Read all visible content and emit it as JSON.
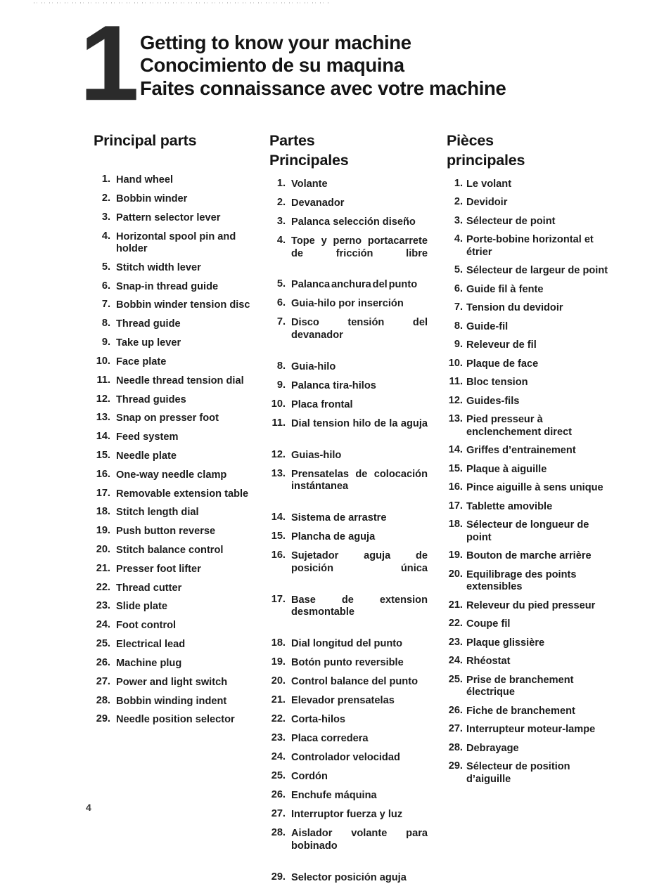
{
  "document": {
    "chapter_number": "1",
    "page_number": "4",
    "titles": [
      "Getting to know your machine",
      "Conocimiento de su maquina",
      "Faites connaissance avec votre machine"
    ]
  },
  "columns": {
    "english": {
      "heading": "Principal parts",
      "items": [
        {
          "num": "1.",
          "label": "Hand wheel"
        },
        {
          "num": "2.",
          "label": "Bobbin winder"
        },
        {
          "num": "3.",
          "label": "Pattern selector lever"
        },
        {
          "num": "4.",
          "label": "Horizontal spool pin and holder"
        },
        {
          "num": "5.",
          "label": "Stitch width lever"
        },
        {
          "num": "6.",
          "label": "Snap-in thread guide"
        },
        {
          "num": "7.",
          "label": "Bobbin winder tension disc"
        },
        {
          "num": "8.",
          "label": "Thread guide"
        },
        {
          "num": "9.",
          "label": "Take up lever"
        },
        {
          "num": "10.",
          "label": "Face plate"
        },
        {
          "num": "11.",
          "label": "Needle thread tension dial"
        },
        {
          "num": "12.",
          "label": "Thread guides"
        },
        {
          "num": "13.",
          "label": "Snap on presser foot"
        },
        {
          "num": "14.",
          "label": "Feed system"
        },
        {
          "num": "15.",
          "label": "Needle plate"
        },
        {
          "num": "16.",
          "label": "One-way needle clamp"
        },
        {
          "num": "17.",
          "label": "Removable extension table"
        },
        {
          "num": "18.",
          "label": "Stitch length dial"
        },
        {
          "num": "19.",
          "label": "Push button reverse"
        },
        {
          "num": "20.",
          "label": "Stitch balance control"
        },
        {
          "num": "21.",
          "label": "Presser foot lifter"
        },
        {
          "num": "22.",
          "label": "Thread cutter"
        },
        {
          "num": "23.",
          "label": "Slide plate"
        },
        {
          "num": "24.",
          "label": "Foot control"
        },
        {
          "num": "25.",
          "label": "Electrical lead"
        },
        {
          "num": "26.",
          "label": "Machine plug"
        },
        {
          "num": "27.",
          "label": "Power and light switch"
        },
        {
          "num": "28.",
          "label": "Bobbin winding indent"
        },
        {
          "num": "29.",
          "label": "Needle position selector"
        }
      ]
    },
    "spanish": {
      "heading": "Partes Principales",
      "heading_line1": "Partes",
      "heading_line2": "Principales",
      "items": [
        {
          "num": "1.",
          "label": "Volante"
        },
        {
          "num": "2.",
          "label": "Devanador"
        },
        {
          "num": "3.",
          "label": "Palanca selección diseño"
        },
        {
          "num": "4.",
          "label": "Tope y perno portacarrete de fricción libre"
        },
        {
          "num": "5.",
          "label": "Palanca anchura del punto"
        },
        {
          "num": "6.",
          "label": "Guia-hilo por inserción"
        },
        {
          "num": "7.",
          "label": "Disco tensión del devanador"
        },
        {
          "num": "8.",
          "label": "Guia-hilo"
        },
        {
          "num": "9.",
          "label": "Palanca tira-hilos"
        },
        {
          "num": "10.",
          "label": "Placa frontal"
        },
        {
          "num": "11.",
          "label": "Dial tension hilo de la aguja"
        },
        {
          "num": "12.",
          "label": "Guias-hilo"
        },
        {
          "num": "13.",
          "label": "Prensatelas de colocación instántanea"
        },
        {
          "num": "14.",
          "label": "Sistema de arrastre"
        },
        {
          "num": "15.",
          "label": "Plancha de aguja"
        },
        {
          "num": "16.",
          "label": "Sujetador aguja de posición única"
        },
        {
          "num": "17.",
          "label": "Base de extension desmontable"
        },
        {
          "num": "18.",
          "label": "Dial longitud del punto"
        },
        {
          "num": "19.",
          "label": "Botón punto reversible"
        },
        {
          "num": "20.",
          "label": "Control balance del punto"
        },
        {
          "num": "21.",
          "label": "Elevador prensatelas"
        },
        {
          "num": "22.",
          "label": "Corta-hilos"
        },
        {
          "num": "23.",
          "label": "Placa corredera"
        },
        {
          "num": "24.",
          "label": "Controlador velocidad"
        },
        {
          "num": "25.",
          "label": "Cordón"
        },
        {
          "num": "26.",
          "label": "Enchufe máquina"
        },
        {
          "num": "27.",
          "label": "Interruptor fuerza y luz"
        },
        {
          "num": "28.",
          "label": "Aislador volante para bobinado"
        },
        {
          "num": "29.",
          "label": "Selector posición aguja"
        }
      ]
    },
    "french": {
      "heading": "Pièces principales",
      "heading_line1": "Pièces",
      "heading_line2": "principales",
      "items": [
        {
          "num": "1.",
          "label": "Le volant"
        },
        {
          "num": "2.",
          "label": "Devidoir"
        },
        {
          "num": "3.",
          "label": "Sélecteur de point"
        },
        {
          "num": "4.",
          "label": "Porte-bobine horizontal et étrier"
        },
        {
          "num": "5.",
          "label": "Sélecteur de largeur de point"
        },
        {
          "num": "6.",
          "label": "Guide fil à fente"
        },
        {
          "num": "7.",
          "label": "Tension du devidoir"
        },
        {
          "num": "8.",
          "label": "Guide-fil"
        },
        {
          "num": "9.",
          "label": "Releveur de fil"
        },
        {
          "num": "10.",
          "label": "Plaque de face"
        },
        {
          "num": "11.",
          "label": "Bloc tension"
        },
        {
          "num": "12.",
          "label": "Guides-fils"
        },
        {
          "num": "13.",
          "label": "Pied presseur à enclenchement direct"
        },
        {
          "num": "14.",
          "label": "Griffes d’entrainement"
        },
        {
          "num": "15.",
          "label": "Plaque à aiguille"
        },
        {
          "num": "16.",
          "label": "Pince aiguille à sens unique"
        },
        {
          "num": "17.",
          "label": "Tablette amovible"
        },
        {
          "num": "18.",
          "label": "Sélecteur de longueur de point"
        },
        {
          "num": "19.",
          "label": "Bouton de marche arrière"
        },
        {
          "num": "20.",
          "label": "Equilibrage des points extensibles"
        },
        {
          "num": "21.",
          "label": "Releveur du pied presseur"
        },
        {
          "num": "22.",
          "label": "Coupe fil"
        },
        {
          "num": "23.",
          "label": "Plaque glissière"
        },
        {
          "num": "24.",
          "label": "Rhéostat"
        },
        {
          "num": "25.",
          "label": "Prise de branchement électrique"
        },
        {
          "num": "26.",
          "label": "Fiche de branchement"
        },
        {
          "num": "27.",
          "label": "Interrupteur moteur-lampe"
        },
        {
          "num": "28.",
          "label": "Debrayage"
        },
        {
          "num": "29.",
          "label": "Sélecteur de position d’aiguille"
        }
      ]
    }
  }
}
